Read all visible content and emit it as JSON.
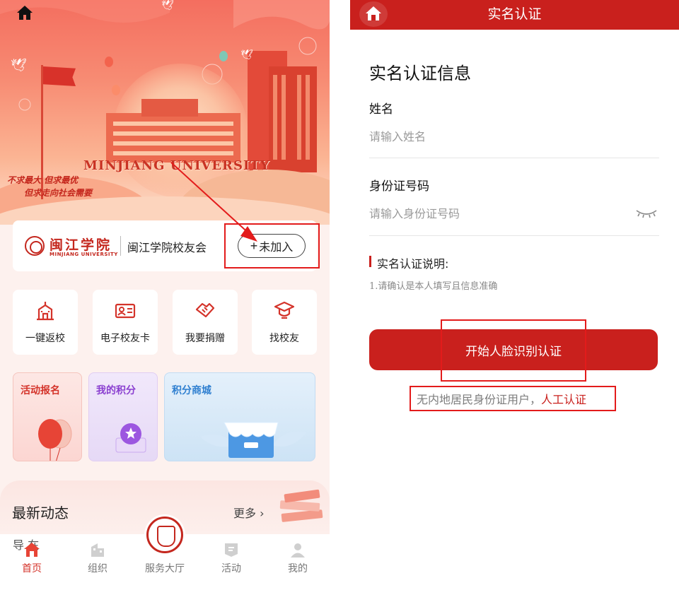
{
  "left_screen": {
    "banner": {
      "university_en": "MINJIANG UNIVERSITY",
      "slogan_line1": "不求最大 但求最优",
      "slogan_line2": "但求走向社会需要"
    },
    "alumni_card": {
      "logo_cn": "闽江学院",
      "logo_en": "MINJIANG UNIVERSITY",
      "club_name": "闽江学院校友会",
      "join_plus": "+",
      "join_label": "未加入"
    },
    "quick_actions": [
      {
        "label": "一键返校",
        "icon": "school-building-icon"
      },
      {
        "label": "电子校友卡",
        "icon": "id-card-icon"
      },
      {
        "label": "我要捐赠",
        "icon": "donate-handshake-icon"
      },
      {
        "label": "找校友",
        "icon": "graduate-cap-icon"
      }
    ],
    "cards": {
      "activity": "活动报名",
      "points": "我的积分",
      "mall": "积分商城"
    },
    "news": {
      "title": "最新动态",
      "more": "更多",
      "more_arrow": "›",
      "peek_text": "导 在"
    },
    "tabbar": [
      {
        "label": "首页",
        "icon": "home-icon",
        "active": true
      },
      {
        "label": "组织",
        "icon": "organization-icon",
        "active": false
      },
      {
        "label": "服务大厅",
        "icon": "university-seal-icon",
        "active": false
      },
      {
        "label": "活动",
        "icon": "activity-flag-icon",
        "active": false
      },
      {
        "label": "我的",
        "icon": "user-icon",
        "active": false
      }
    ],
    "colors": {
      "accent": "#d4332a",
      "banner_top": "#f46e5f"
    }
  },
  "right_screen": {
    "header_title": "实名认证",
    "section_title": "实名认证信息",
    "name_label": "姓名",
    "name_placeholder": "请输入姓名",
    "id_label": "身份证号码",
    "id_placeholder": "请输入身份证号码",
    "note_title": "实名认证说明:",
    "note_text": "1.请确认是本人填写且信息准确",
    "start_button": "开始人脸识别认证",
    "manual_prefix": "无内地居民身份证用户，",
    "manual_link": "人工认证",
    "colors": {
      "header": "#c9201d",
      "button": "#c9201d"
    }
  }
}
